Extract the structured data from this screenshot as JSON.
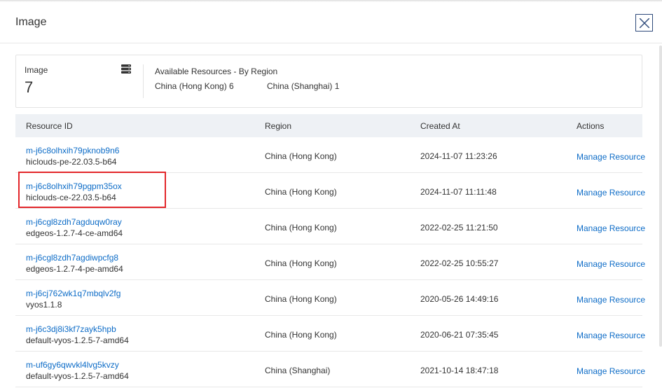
{
  "dialog": {
    "title": "Image"
  },
  "summary": {
    "label": "Image",
    "count": "7",
    "available_title": "Available Resources - By Region",
    "regions": [
      "China (Hong Kong) 6",
      "China (Shanghai) 1"
    ]
  },
  "table": {
    "columns": [
      "Resource ID",
      "Region",
      "Created At",
      "Actions"
    ],
    "rows": [
      {
        "id": "m-j6c8olhxih79pknob9n6",
        "name": "hiclouds-pe-22.03.5-b64",
        "region": "China (Hong Kong)",
        "created": "2024-11-07 11:23:26",
        "action": "Manage Resource"
      },
      {
        "id": "m-j6c8olhxih79pgpm35ox",
        "name": "hiclouds-ce-22.03.5-b64",
        "region": "China (Hong Kong)",
        "created": "2024-11-07 11:11:48",
        "action": "Manage Resource"
      },
      {
        "id": "m-j6cgl8zdh7agduqw0ray",
        "name": "edgeos-1.2.7-4-ce-amd64",
        "region": "China (Hong Kong)",
        "created": "2022-02-25 11:21:50",
        "action": "Manage Resource"
      },
      {
        "id": "m-j6cgl8zdh7agdiwpcfg8",
        "name": "edgeos-1.2.7-4-pe-amd64",
        "region": "China (Hong Kong)",
        "created": "2022-02-25 10:55:27",
        "action": "Manage Resource"
      },
      {
        "id": "m-j6cj762wk1q7mbqlv2fg",
        "name": "vyos1.1.8",
        "region": "China (Hong Kong)",
        "created": "2020-05-26 14:49:16",
        "action": "Manage Resource"
      },
      {
        "id": "m-j6c3dj8i3kf7zayk5hpb",
        "name": "default-vyos-1.2.5-7-amd64",
        "region": "China (Hong Kong)",
        "created": "2020-06-21 07:35:45",
        "action": "Manage Resource"
      },
      {
        "id": "m-uf6gy6qwvkl4lvg5kvzy",
        "name": "default-vyos-1.2.5-7-amd64",
        "region": "China (Shanghai)",
        "created": "2021-10-14 18:47:18",
        "action": "Manage Resource"
      }
    ]
  },
  "icons": {
    "close": "close-icon",
    "database": "database-icon"
  },
  "colors": {
    "link": "#0d6cc7",
    "highlight": "#e3262a",
    "header_bg": "#eef1f5"
  }
}
